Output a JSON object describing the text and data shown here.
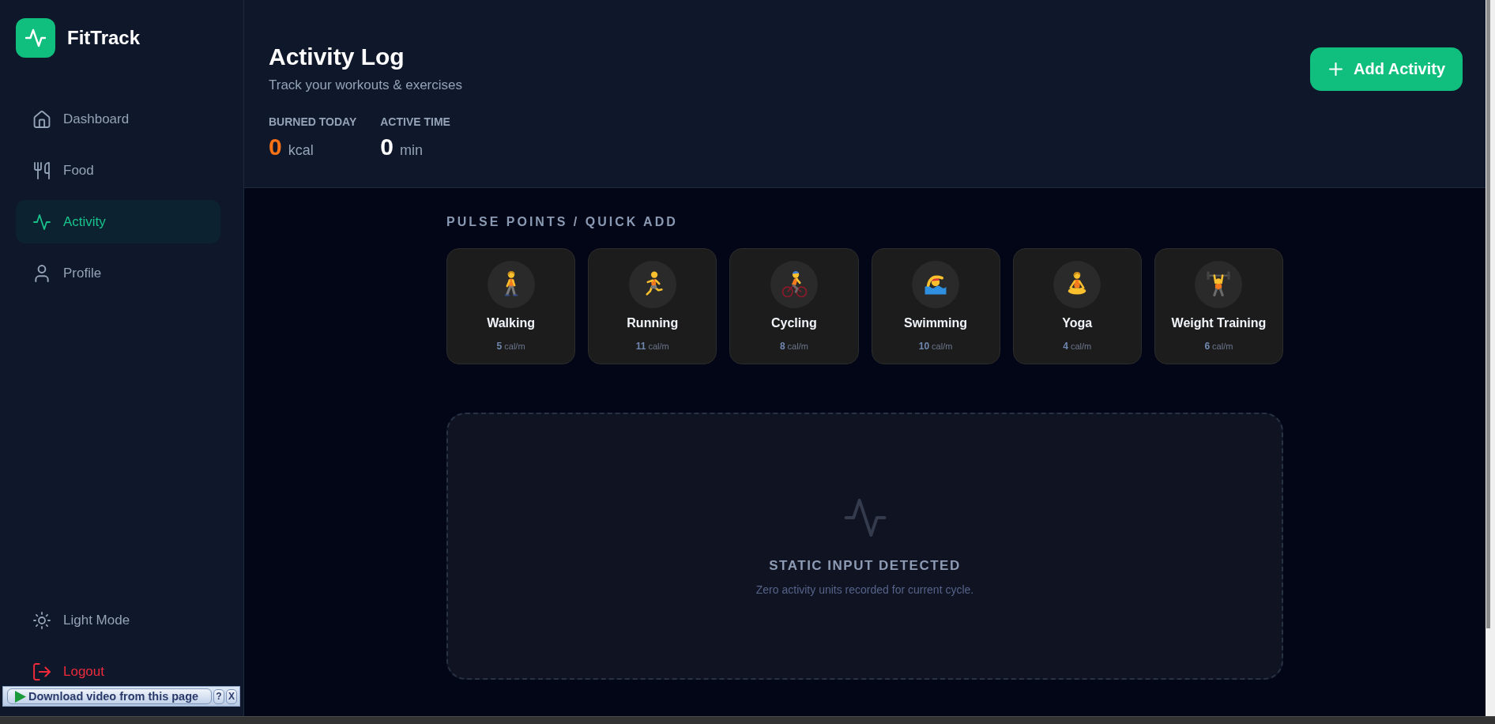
{
  "sidebar": {
    "brand": "FitTrack",
    "nav": [
      {
        "label": "Dashboard",
        "selected": false
      },
      {
        "label": "Food",
        "selected": false
      },
      {
        "label": "Activity",
        "selected": true
      },
      {
        "label": "Profile",
        "selected": false
      }
    ],
    "footer": [
      {
        "label": "Light Mode",
        "kind": "theme"
      },
      {
        "label": "Logout",
        "kind": "logout"
      }
    ]
  },
  "header": {
    "title": "Activity Log",
    "subtitle": "Track your workouts & exercises",
    "stats": [
      {
        "label": "BURNED TODAY",
        "value": "0",
        "unit": "kcal",
        "color": "#f97316"
      },
      {
        "label": "ACTIVE TIME",
        "value": "0",
        "unit": "min",
        "color": "#ffffff"
      }
    ],
    "add_button": "Add Activity"
  },
  "quick_add": {
    "heading": "PULSE POINTS / QUICK ADD",
    "items": [
      {
        "name": "Walking",
        "rate": "5",
        "unit": "cal/m"
      },
      {
        "name": "Running",
        "rate": "11",
        "unit": "cal/m"
      },
      {
        "name": "Cycling",
        "rate": "8",
        "unit": "cal/m"
      },
      {
        "name": "Swimming",
        "rate": "10",
        "unit": "cal/m"
      },
      {
        "name": "Yoga",
        "rate": "4",
        "unit": "cal/m"
      },
      {
        "name": "Weight Training",
        "rate": "6",
        "unit": "cal/m"
      }
    ]
  },
  "empty_state": {
    "title": "STATIC INPUT DETECTED",
    "message": "Zero activity units recorded for current cycle."
  },
  "download_bar": {
    "label": "Download video from this page",
    "help": "?",
    "close": "X"
  }
}
